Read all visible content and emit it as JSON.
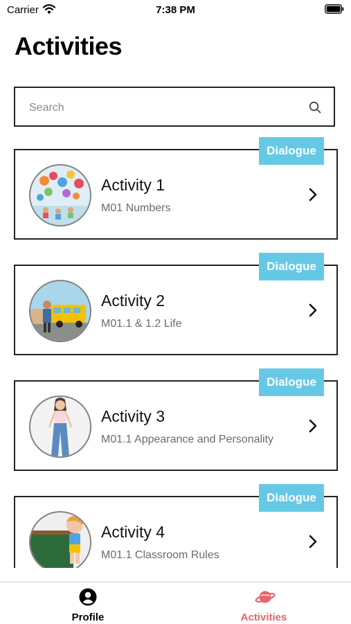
{
  "status_bar": {
    "carrier": "Carrier",
    "time": "7:38 PM"
  },
  "page": {
    "title": "Activities"
  },
  "search": {
    "placeholder": "Search"
  },
  "activities": [
    {
      "title": "Activity 1",
      "subtitle": "M01 Numbers",
      "badge": "Dialogue"
    },
    {
      "title": "Activity 2",
      "subtitle": "M01.1 & 1.2 Life",
      "badge": "Dialogue"
    },
    {
      "title": "Activity 3",
      "subtitle": "M01.1 Appearance and Personality",
      "badge": "Dialogue"
    },
    {
      "title": "Activity 4",
      "subtitle": "M01.1 Classroom Rules",
      "badge": "Dialogue"
    }
  ],
  "tab_bar": {
    "tabs": [
      {
        "label": "Profile",
        "icon": "person-circle-icon",
        "active": false
      },
      {
        "label": "Activities",
        "icon": "planet-icon",
        "active": true
      }
    ]
  },
  "colors": {
    "badge": "#65c9e6",
    "active_tab": "#e8646a",
    "border": "#222222"
  }
}
